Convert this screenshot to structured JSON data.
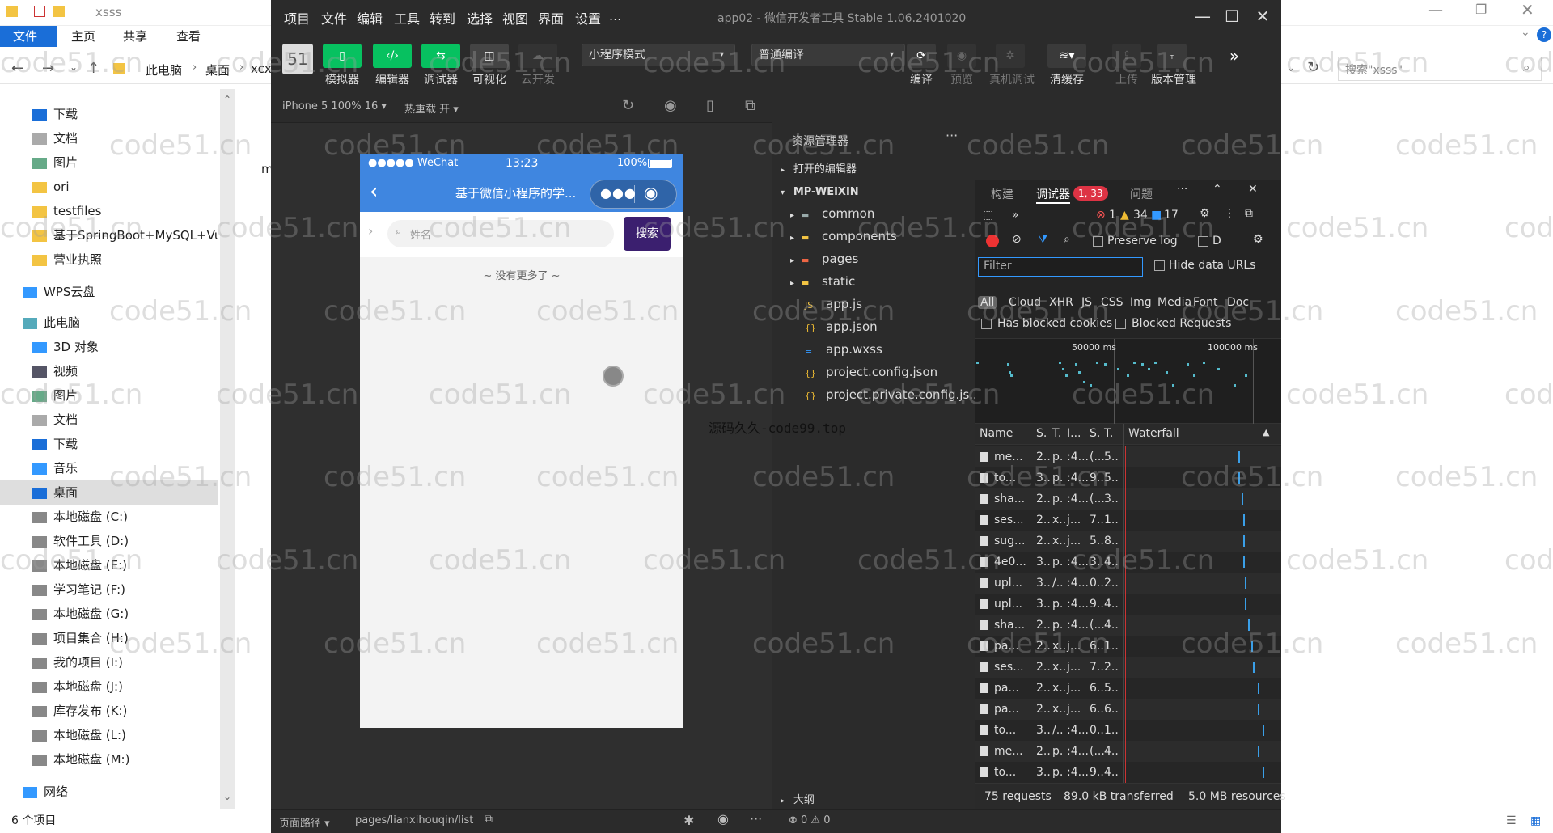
{
  "explorer": {
    "title": "xsss",
    "tabs": [
      "文件",
      "主页",
      "共享",
      "查看"
    ],
    "breadcrumb": [
      "此电脑",
      "桌面",
      "xcx"
    ],
    "search_placeholder": "搜索\"xsss\"",
    "col_letter": "m",
    "sidebar": [
      "下载",
      "文档",
      "图片",
      "ori",
      "testfiles",
      "基于SpringBoot+MySQL+Vu",
      "营业执照",
      "WPS云盘",
      "此电脑",
      "3D 对象",
      "视频",
      "图片",
      "文档",
      "下载",
      "音乐",
      "桌面",
      "本地磁盘 (C:)",
      "软件工具 (D:)",
      "本地磁盘 (E:)",
      "学习笔记 (F:)",
      "本地磁盘 (G:)",
      "项目集合 (H:)",
      "我的项目 (I:)",
      "本地磁盘 (J:)",
      "库存发布 (K:)",
      "本地磁盘 (L:)",
      "本地磁盘 (M:)",
      "网络"
    ],
    "status": "6 个项目"
  },
  "devtool": {
    "title": "app02 - 微信开发者工具 Stable 1.06.2401020",
    "menu": [
      "项目",
      "文件",
      "编辑",
      "工具",
      "转到",
      "选择",
      "视图",
      "界面",
      "设置",
      "..."
    ],
    "toolbar": {
      "buttons": [
        "模拟器",
        "编辑器",
        "调试器",
        "可视化",
        "云开发"
      ],
      "mode": "小程序模式",
      "compile": "普通编译",
      "right_labels": [
        "编译",
        "预览",
        "真机调试",
        "清缓存",
        "上传",
        "版本管理"
      ]
    },
    "sim": {
      "device": "iPhone 5 100% 16 ▾",
      "hot_reload": "热重载 开 ▾",
      "status_carrier": "●●●●● WeChat",
      "status_time": "13:23",
      "status_battery": "100%",
      "nav_title": "基于微信小程序的学...",
      "search_placeholder": "姓名",
      "search_btn": "搜索",
      "no_more": "~ 没有更多了 ~"
    },
    "tree": {
      "header": "资源管理器",
      "open_editors": "打开的编辑器",
      "project": "MP-WEIXIN",
      "items": [
        "common",
        "components",
        "pages",
        "static",
        "app.js",
        "app.json",
        "app.wxss",
        "project.config.json",
        "project.private.config.js..."
      ],
      "outline": "大纲"
    },
    "panel": {
      "tabs": [
        "构建",
        "调试器",
        "问题"
      ],
      "badge": "1, 33",
      "errors": "1",
      "warnings": "34",
      "infos": "17",
      "preserve_log": "Preserve log",
      "disable": "D",
      "filter_placeholder": "Filter",
      "hide_data_urls": "Hide data URLs",
      "types": [
        "All",
        "Cloud",
        "XHR",
        "JS",
        "CSS",
        "Img",
        "Media",
        "Font",
        "Doc"
      ],
      "has_blocked": "Has blocked cookies",
      "blocked_requests": "Blocked Requests",
      "timeline_labels": [
        "50000 ms",
        "100000 ms"
      ],
      "columns": [
        "Name",
        "S.",
        "T.",
        "I...",
        "S.",
        "T.",
        "Waterfall"
      ],
      "rows": [
        [
          "me...",
          "2..",
          "p.",
          ":4...",
          "(...",
          "5.."
        ],
        [
          "to...",
          "3..",
          "p.",
          ":4...",
          "9..",
          "5.."
        ],
        [
          "sha...",
          "2..",
          "p.",
          ":4...",
          "(...",
          "3.."
        ],
        [
          "ses...",
          "2..",
          "x..",
          "j...",
          "7..",
          "1.."
        ],
        [
          "sug...",
          "2..",
          "x..",
          "j...",
          "5..",
          "8.."
        ],
        [
          "4e0...",
          "3..",
          "p.",
          ":4...",
          "3..",
          "4.."
        ],
        [
          "upl...",
          "3..",
          "/..",
          ":4...",
          "0..",
          "2.."
        ],
        [
          "upl...",
          "3..",
          "p.",
          ":4...",
          "9..",
          "4.."
        ],
        [
          "sha...",
          "2..",
          "p.",
          ":4...",
          "(...",
          "4.."
        ],
        [
          "pa...",
          "2..",
          "x..",
          "j...",
          "6..",
          "1.."
        ],
        [
          "ses...",
          "2..",
          "x..",
          "j...",
          "7..",
          "2.."
        ],
        [
          "pa...",
          "2..",
          "x..",
          "j...",
          "6..",
          "5.."
        ],
        [
          "pa...",
          "2..",
          "x..",
          "j...",
          "6..",
          "6.."
        ],
        [
          "to...",
          "3..",
          "/..",
          ":4...",
          "0..",
          "1.."
        ],
        [
          "me...",
          "2..",
          "p.",
          ":4...",
          "(...",
          "4.."
        ],
        [
          "to...",
          "3..",
          "p.",
          ":4...",
          "9..",
          "4.."
        ]
      ],
      "summary": [
        "75 requests",
        "89.0 kB transferred",
        "5.0 MB resources"
      ]
    },
    "bottom": {
      "path_label": "页面路径 ▾",
      "path": "pages/lianxihouqin/list",
      "errors": "⊗ 0 ⚠ 0"
    }
  },
  "overlay_text": "源码久久-code99.top",
  "watermark": "code51.cn"
}
